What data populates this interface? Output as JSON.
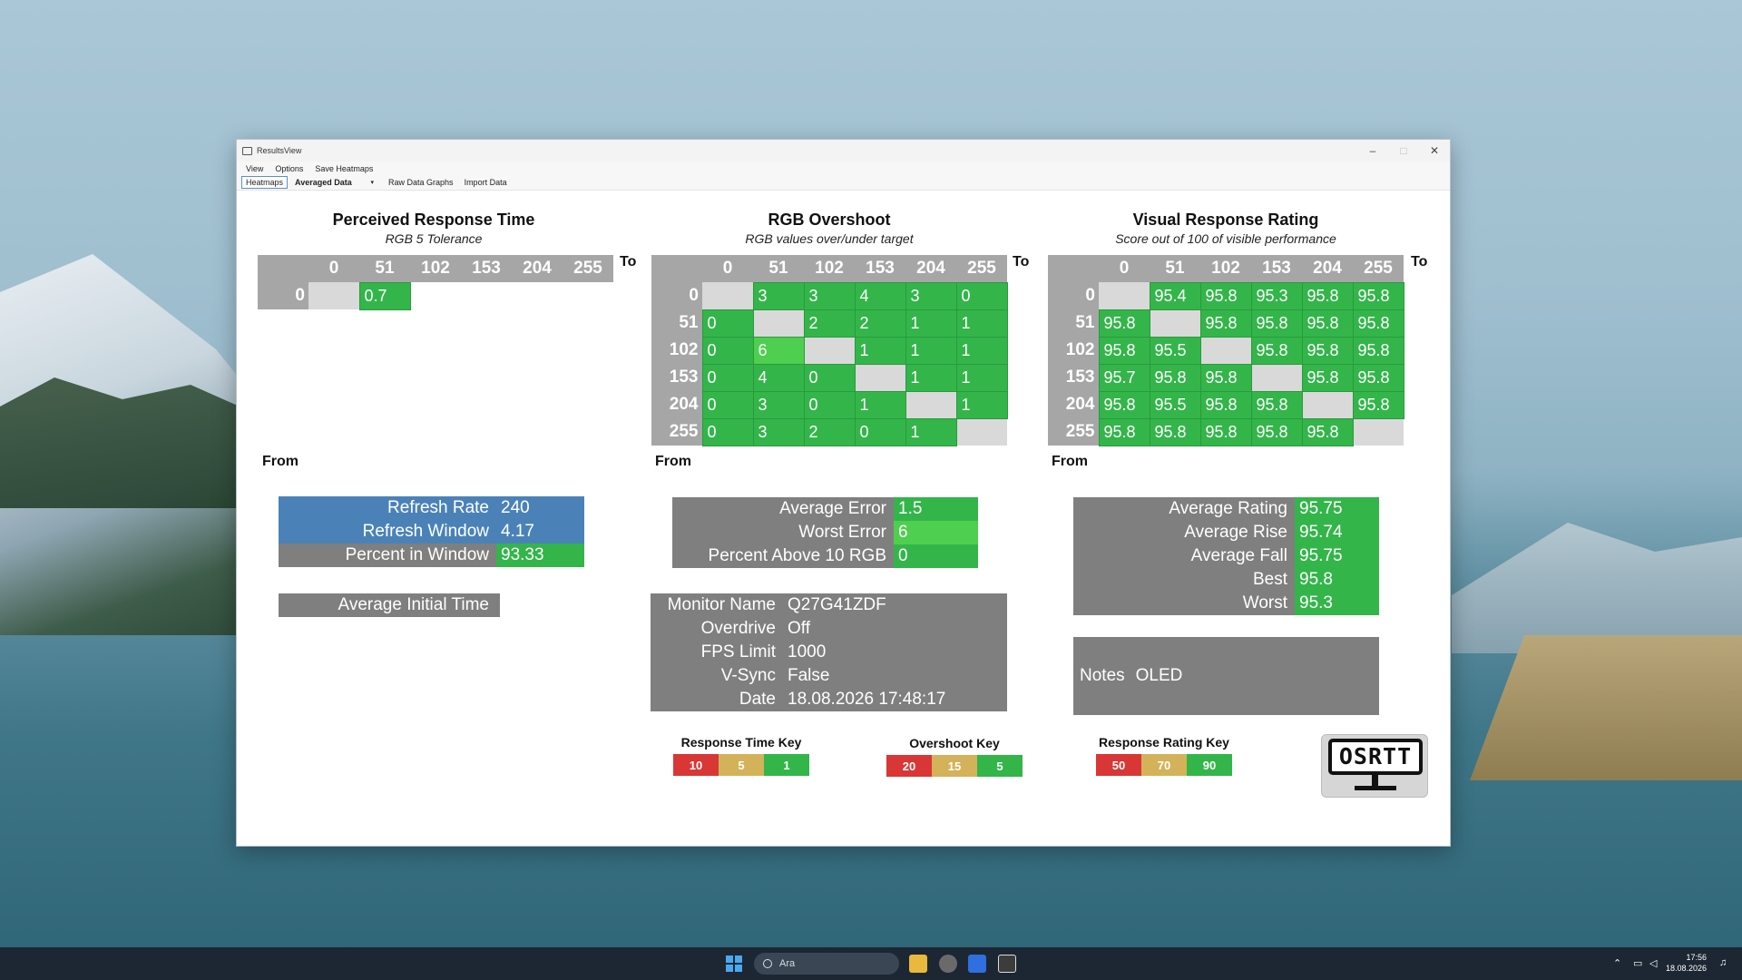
{
  "window": {
    "title": "ResultsView",
    "menu": [
      "View",
      "Options",
      "Save Heatmaps"
    ],
    "tabs": {
      "heatmaps": "Heatmaps",
      "averaged": "Averaged Data",
      "raw": "Raw Data Graphs",
      "import": "Import Data"
    }
  },
  "prt": {
    "title": "Perceived Response Time",
    "subtitle": "RGB 5 Tolerance",
    "cols": [
      "0",
      "51",
      "102",
      "153",
      "204",
      "255"
    ],
    "to": "To",
    "from": "From",
    "rows": [
      {
        "label": "0",
        "cells": [
          "",
          "0.7",
          "",
          "",
          "",
          ""
        ]
      }
    ]
  },
  "overshoot": {
    "title": "RGB Overshoot",
    "subtitle": "RGB values over/under target",
    "cols": [
      "0",
      "51",
      "102",
      "153",
      "204",
      "255"
    ],
    "to": "To",
    "from": "From",
    "rows": [
      {
        "label": "0",
        "cells": [
          "",
          "3",
          "3",
          "4",
          "3",
          "0"
        ]
      },
      {
        "label": "51",
        "cells": [
          "0",
          "",
          "2",
          "2",
          "1",
          "1"
        ]
      },
      {
        "label": "102",
        "cells": [
          "0",
          "6",
          "",
          "1",
          "1",
          "1"
        ]
      },
      {
        "label": "153",
        "cells": [
          "0",
          "4",
          "0",
          "",
          "1",
          "1"
        ]
      },
      {
        "label": "204",
        "cells": [
          "0",
          "3",
          "0",
          "1",
          "",
          "1"
        ]
      },
      {
        "label": "255",
        "cells": [
          "0",
          "3",
          "2",
          "0",
          "1",
          ""
        ]
      }
    ]
  },
  "vrr": {
    "title": "Visual Response Rating",
    "subtitle": "Score out of 100 of visible performance",
    "cols": [
      "0",
      "51",
      "102",
      "153",
      "204",
      "255"
    ],
    "to": "To",
    "from": "From",
    "rows": [
      {
        "label": "0",
        "cells": [
          "",
          "95.4",
          "95.8",
          "95.3",
          "95.8",
          "95.8"
        ]
      },
      {
        "label": "51",
        "cells": [
          "95.8",
          "",
          "95.8",
          "95.8",
          "95.8",
          "95.8"
        ]
      },
      {
        "label": "102",
        "cells": [
          "95.8",
          "95.5",
          "",
          "95.8",
          "95.8",
          "95.8"
        ]
      },
      {
        "label": "153",
        "cells": [
          "95.7",
          "95.8",
          "95.8",
          "",
          "95.8",
          "95.8"
        ]
      },
      {
        "label": "204",
        "cells": [
          "95.8",
          "95.5",
          "95.8",
          "95.8",
          "",
          "95.8"
        ]
      },
      {
        "label": "255",
        "cells": [
          "95.8",
          "95.8",
          "95.8",
          "95.8",
          "95.8",
          ""
        ]
      }
    ]
  },
  "refresh": {
    "rate_label": "Refresh Rate",
    "rate": "240",
    "window_label": "Refresh Window",
    "window": "4.17",
    "percent_label": "Percent in Window",
    "percent": "93.33",
    "initial_label": "Average Initial Time"
  },
  "error": {
    "avg_label": "Average Error",
    "avg": "1.5",
    "worst_label": "Worst Error",
    "worst": "6",
    "above_label": "Percent Above 10 RGB",
    "above": "0"
  },
  "monitor": {
    "name_label": "Monitor Name",
    "name": "Q27G41ZDF",
    "overdrive_label": "Overdrive",
    "overdrive": "Off",
    "fps_label": "FPS Limit",
    "fps": "1000",
    "vsync_label": "V-Sync",
    "vsync": "False",
    "date_label": "Date",
    "date": "18.08.2026 17:48:17"
  },
  "rating": {
    "avg_label": "Average Rating",
    "avg": "95.75",
    "rise_label": "Average Rise",
    "rise": "95.74",
    "fall_label": "Average Fall",
    "fall": "95.75",
    "best_label": "Best",
    "best": "95.8",
    "worst_label": "Worst",
    "worst": "95.3"
  },
  "notes": {
    "label": "Notes",
    "value": "OLED"
  },
  "keys": {
    "response": {
      "title": "Response Time Key",
      "values": [
        "10",
        "5",
        "1"
      ]
    },
    "overshoot": {
      "title": "Overshoot Key",
      "values": [
        "20",
        "15",
        "5"
      ]
    },
    "rating": {
      "title": "Response Rating Key",
      "values": [
        "50",
        "70",
        "90"
      ]
    }
  },
  "logo": "OSRTT",
  "colors": {
    "green": "#33b54a",
    "red": "#d93636",
    "yellow": "#d4b25a",
    "blue": "#4a82b8",
    "gray": "#7f7f7f"
  },
  "taskbar": {
    "search": "Ara",
    "time": "17:56",
    "date": "18.08.2026"
  }
}
